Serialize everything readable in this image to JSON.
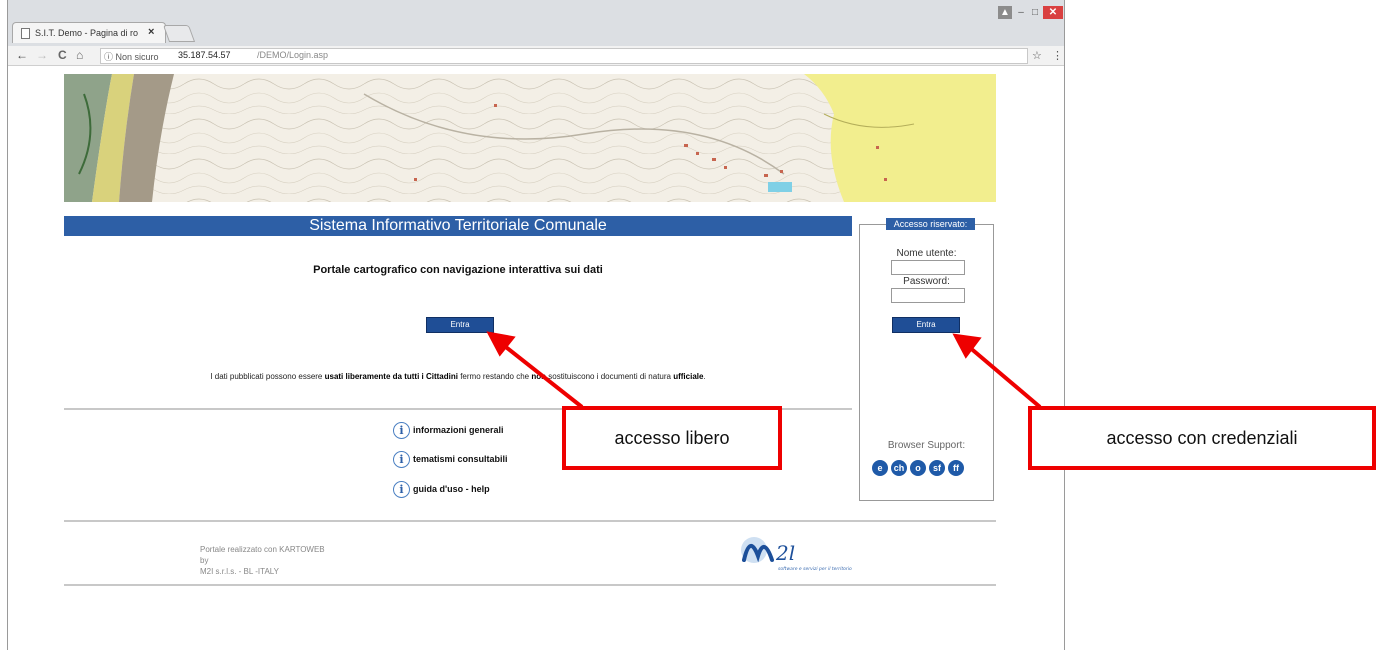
{
  "browser": {
    "tab_title": "S.I.T. Demo - Pagina di ro",
    "tab_close": "×",
    "nav_back": "←",
    "nav_forward": "→",
    "nav_reload": "C",
    "nav_home": "⌂",
    "url_security": "ⓘ Non sicuro",
    "url_host": "35.187.54.57",
    "url_path": "/DEMO/Login.asp",
    "bookmark": "☆",
    "menu": "⋮",
    "win_min": "–",
    "win_max": "□",
    "win_close": "✕"
  },
  "page": {
    "title": "Sistema Informativo Territoriale Comunale",
    "subtitle": "Portale cartografico con navigazione interattiva sui dati",
    "enter_button": "Entra",
    "disclaimer": {
      "p1": "I dati pubblicati possono essere ",
      "b1": "usati liberamente da tutti i Cittadini",
      "p2": " fermo restando che ",
      "b2": "non",
      "p3": " sostituiscono i documenti di natura ",
      "b3": "ufficiale",
      "p4": "."
    },
    "info_links": [
      "informazioni generali",
      "tematismi consultabili",
      "guida d'uso - help"
    ],
    "info_icon": "i",
    "footer": [
      "Portale realizzato con KARTOWEB",
      "by",
      "M2I s.r.l.s. - BL -ITALY"
    ],
    "logo_text": "M2l",
    "logo_tagline": "software e servizi per il territorio"
  },
  "login": {
    "legend": "Accesso riservato:",
    "username_label": "Nome utente:",
    "password_label": "Password:",
    "username_value": "",
    "password_value": "",
    "submit": "Entra",
    "browser_support": "Browser Support:",
    "browser_icons": [
      "e",
      "ch",
      "o",
      "sf",
      "ff"
    ]
  },
  "annotations": {
    "free": "accesso libero",
    "credentials": "accesso con credenziali"
  },
  "colors": {
    "header_blue": "#2d5fa6",
    "button_blue": "#1f4e96",
    "annotation_red": "#ee0000"
  }
}
